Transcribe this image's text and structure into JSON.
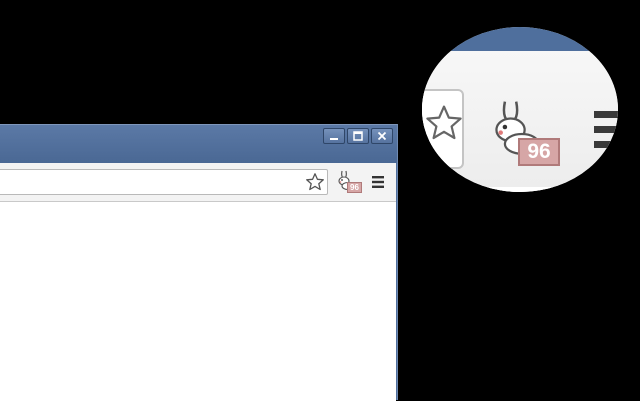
{
  "window": {
    "controls": [
      {
        "name": "minimize-icon"
      },
      {
        "name": "maximize-icon"
      },
      {
        "name": "close-icon"
      }
    ]
  },
  "toolbar": {
    "bookmark_icon": "star-icon",
    "extension": {
      "icon": "rabbit-icon",
      "badge_text": "96",
      "badge_color": "#d6a6a6"
    },
    "menu_icon": "hamburger-menu-icon"
  },
  "magnifier": {
    "badge_text": "96"
  },
  "colors": {
    "frame": "#4f6f9d",
    "toolbar": "#f3f3f3",
    "background": "#000000"
  }
}
